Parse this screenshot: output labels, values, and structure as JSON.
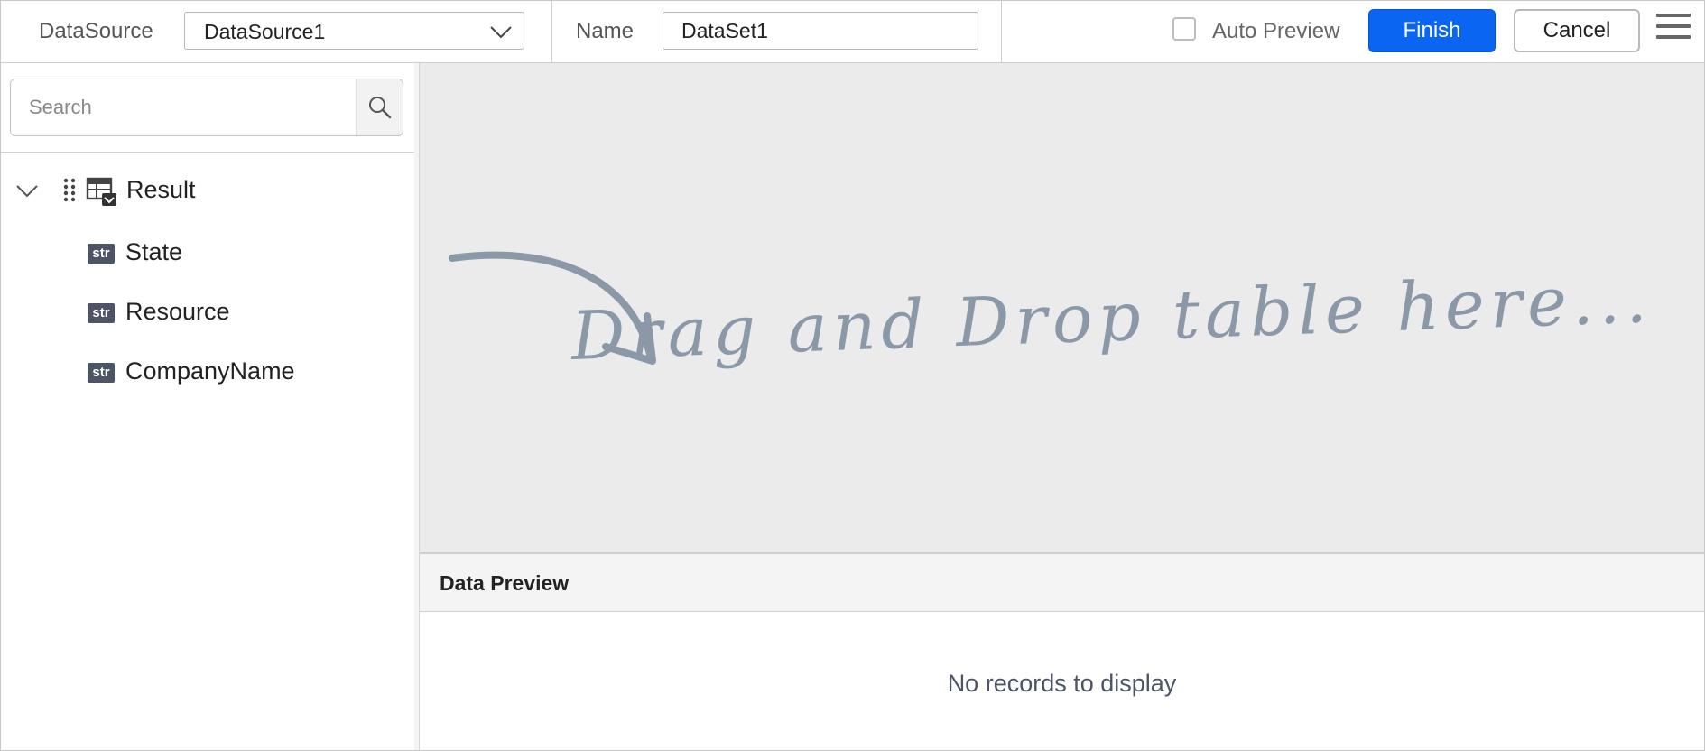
{
  "toolbar": {
    "datasource_label": "DataSource",
    "datasource_value": "DataSource1",
    "name_label": "Name",
    "name_value": "DataSet1",
    "auto_preview_label": "Auto Preview",
    "auto_preview_checked": false,
    "finish_label": "Finish",
    "cancel_label": "Cancel",
    "menu_icon": "hamburger-menu-icon"
  },
  "sidebar": {
    "search_placeholder": "Search",
    "search_icon": "search-icon",
    "tree": {
      "root": {
        "label": "Result",
        "expanded": true,
        "icon": "table-icon",
        "drag_icon": "drag-handle-icon"
      },
      "fields": [
        {
          "type_badge": "str",
          "label": "State"
        },
        {
          "type_badge": "str",
          "label": "Resource"
        },
        {
          "type_badge": "str",
          "label": "CompanyName"
        }
      ]
    }
  },
  "canvas": {
    "drop_hint": "Drag and Drop table here..."
  },
  "data_preview": {
    "title": "Data Preview",
    "empty_message": "No records to display"
  },
  "colors": {
    "primary": "#0a66f2",
    "canvas_bg": "#ebebeb",
    "hint_text": "#8a98a8",
    "badge_bg": "#4b5566"
  }
}
